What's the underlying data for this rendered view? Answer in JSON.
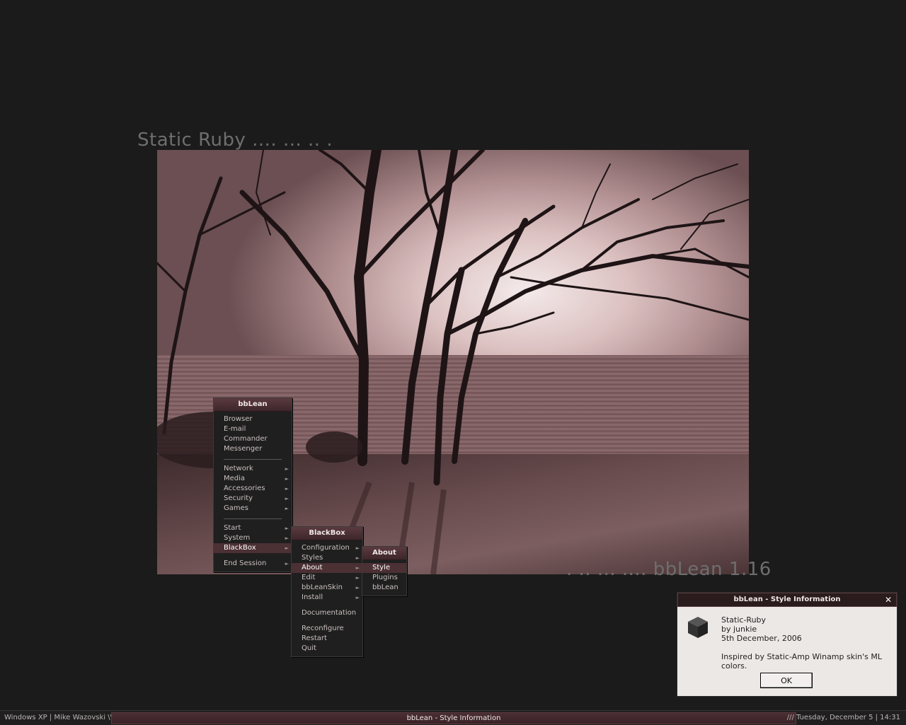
{
  "desktop": {
    "title_banner": "Static Ruby .... ... .. .",
    "version_banner": ". .. ... .... bbLean 1.16"
  },
  "colors": {
    "background": "#1b1b1b",
    "accent": "#4b3034",
    "menu_title": "#3d262a",
    "dialog_bg": "#ece8e6"
  },
  "main_menu": {
    "title": "bbLean",
    "items": {
      "browser": "Browser",
      "email": "E-mail",
      "commander": "Commander",
      "messenger": "Messenger",
      "network": "Network",
      "media": "Media",
      "accessories": "Accessories",
      "security": "Security",
      "games": "Games",
      "start": "Start",
      "system": "System",
      "blackbox": "BlackBox",
      "end_session": "End Session"
    }
  },
  "blackbox_menu": {
    "title": "BlackBox",
    "items": {
      "configuration": "Configuration",
      "styles": "Styles",
      "about": "About",
      "edit": "Edit",
      "bbleanskin": "bbLeanSkin",
      "install": "Install",
      "documentation": "Documentation",
      "reconfigure": "Reconfigure",
      "restart": "Restart",
      "quit": "Quit"
    }
  },
  "about_menu": {
    "title": "About",
    "items": {
      "style": "Style",
      "plugins": "Plugins",
      "bblean": "bbLean"
    }
  },
  "dialog": {
    "title": "bbLean - Style Information",
    "icon": "cube-icon",
    "style_name": "Static-Ruby",
    "author": "by junkie",
    "date": "5th December, 2006",
    "description": "Inspired by Static-Amp Winamp skin's ML colors.",
    "ok_label": "OK"
  },
  "taskbar": {
    "left_text": "Windows XP | Mike Wazovski \\\\\\",
    "task_label": "bbLean - Style Information",
    "right_text": "/// Tuesday, December 5 | 14:31"
  }
}
